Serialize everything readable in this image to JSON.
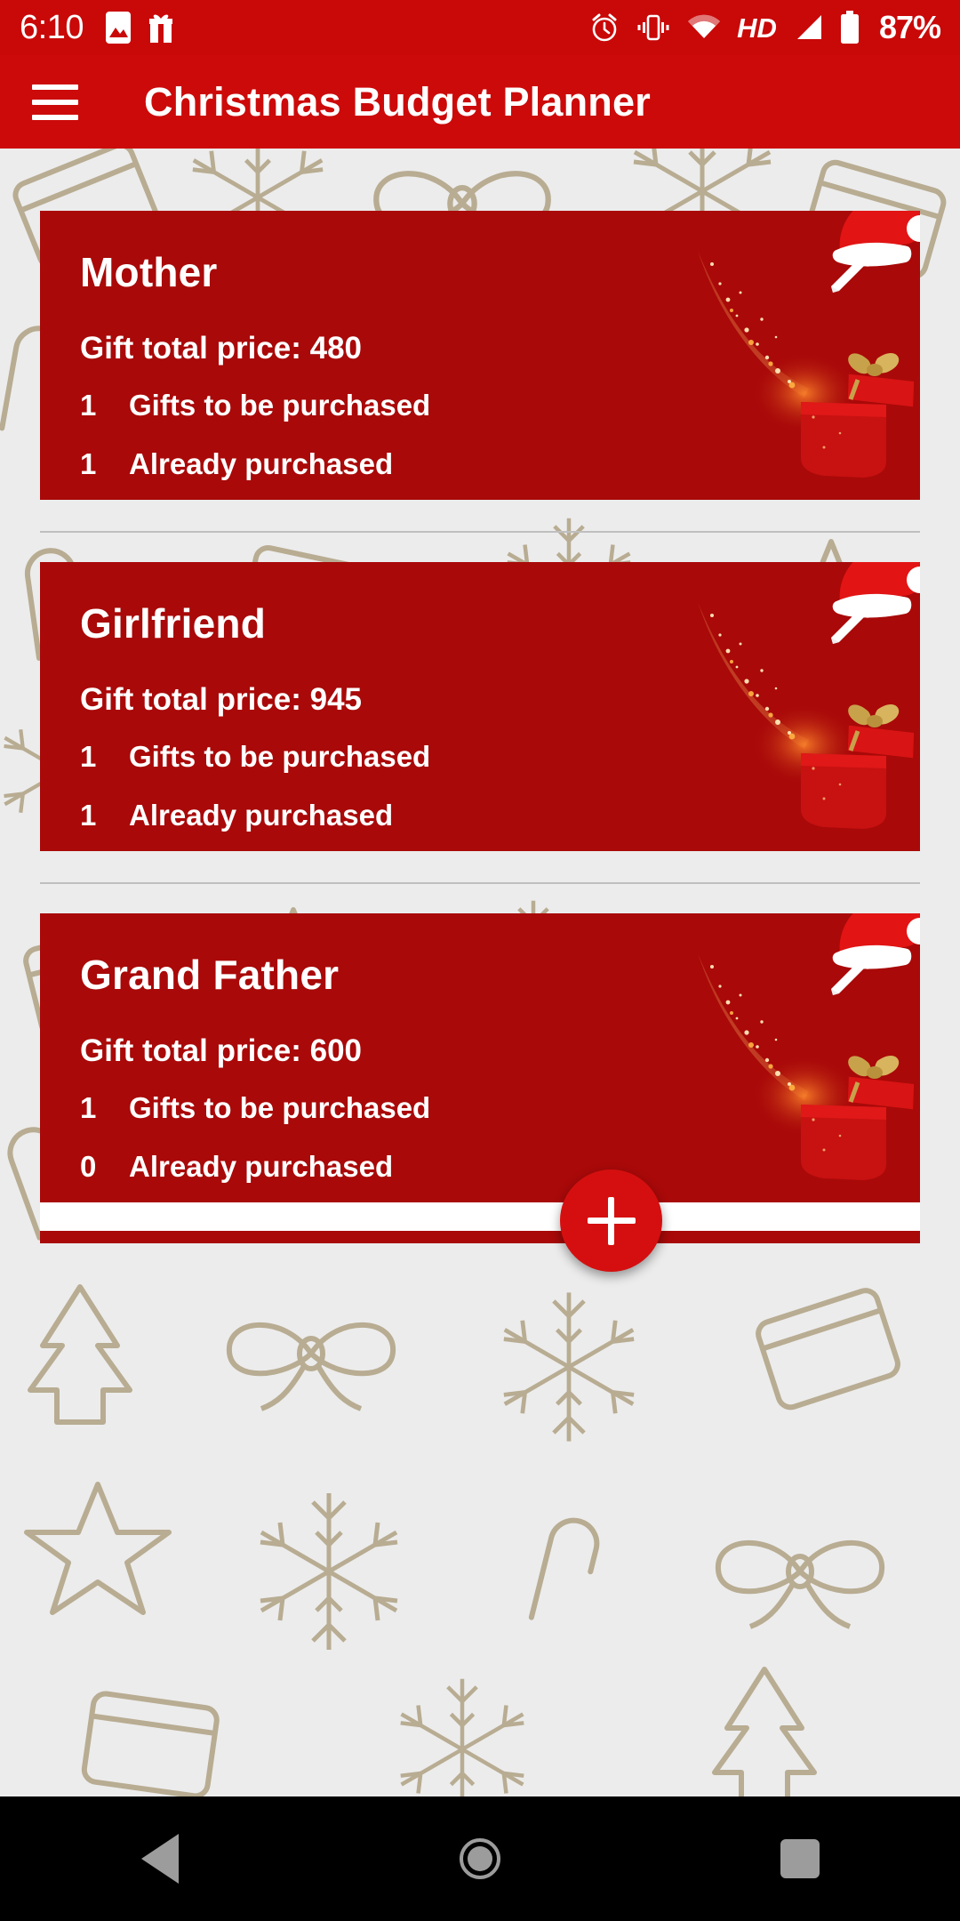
{
  "status_bar": {
    "time": "6:10",
    "battery_percent": "87%",
    "left_icons": [
      "image-icon",
      "gift-icon"
    ],
    "right_icons": [
      "alarm-icon",
      "vibrate-icon",
      "wifi-icon",
      "hd-icon",
      "signal-icon",
      "battery-icon"
    ],
    "hd_label": "HD",
    "background_color": "#C90808"
  },
  "app_bar": {
    "title": "Christmas Budget Planner",
    "menu_icon": "hamburger-menu-icon",
    "background_color": "#CC0A0A"
  },
  "theme": {
    "card_red": "#A90909",
    "accent_red": "#D50F0F",
    "content_bg": "#ECECEC",
    "pattern_color": "#B8AC92"
  },
  "cards": [
    {
      "name": "Mother",
      "total_label": "Gift total price: 480",
      "rows": [
        {
          "qty": "1",
          "label": "Gifts to be purchased"
        },
        {
          "qty": "1",
          "label": "Already purchased"
        }
      ],
      "edit_icon": "pencil-edit-icon",
      "decor_icon": "santa-hat-icon"
    },
    {
      "name": "Girlfriend",
      "total_label": "Gift total price: 945",
      "rows": [
        {
          "qty": "1",
          "label": "Gifts to be purchased"
        },
        {
          "qty": "1",
          "label": "Already purchased"
        }
      ],
      "edit_icon": "pencil-edit-icon",
      "decor_icon": "santa-hat-icon"
    },
    {
      "name": "Grand Father",
      "total_label": "Gift total price: 600",
      "rows": [
        {
          "qty": "1",
          "label": "Gifts to be purchased"
        },
        {
          "qty": "0",
          "label": "Already purchased"
        }
      ],
      "edit_icon": "pencil-edit-icon",
      "decor_icon": "santa-hat-icon"
    }
  ],
  "fab": {
    "icon": "plus-icon",
    "label": "+"
  },
  "nav_bar": {
    "back": "back-triangle-icon",
    "home": "home-circle-icon",
    "recents": "recents-square-icon"
  }
}
